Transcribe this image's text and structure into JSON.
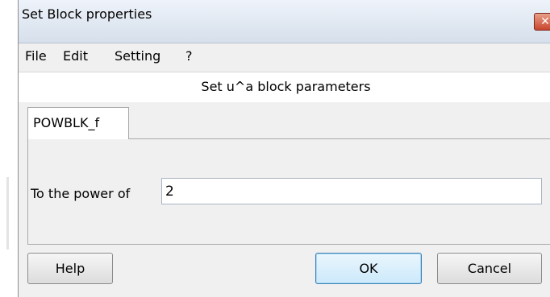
{
  "window": {
    "title": "Set Block properties",
    "close_symbol": "✕"
  },
  "menu": {
    "items": [
      "File",
      "Edit",
      "Setting",
      "?"
    ]
  },
  "header": {
    "text": "Set u^a block parameters"
  },
  "tabs": [
    {
      "label": "POWBLK_f",
      "selected": true
    }
  ],
  "form": {
    "power_label": "To the power of",
    "power_value": "2"
  },
  "buttons": {
    "help": "Help",
    "ok": "OK",
    "cancel": "Cancel"
  }
}
